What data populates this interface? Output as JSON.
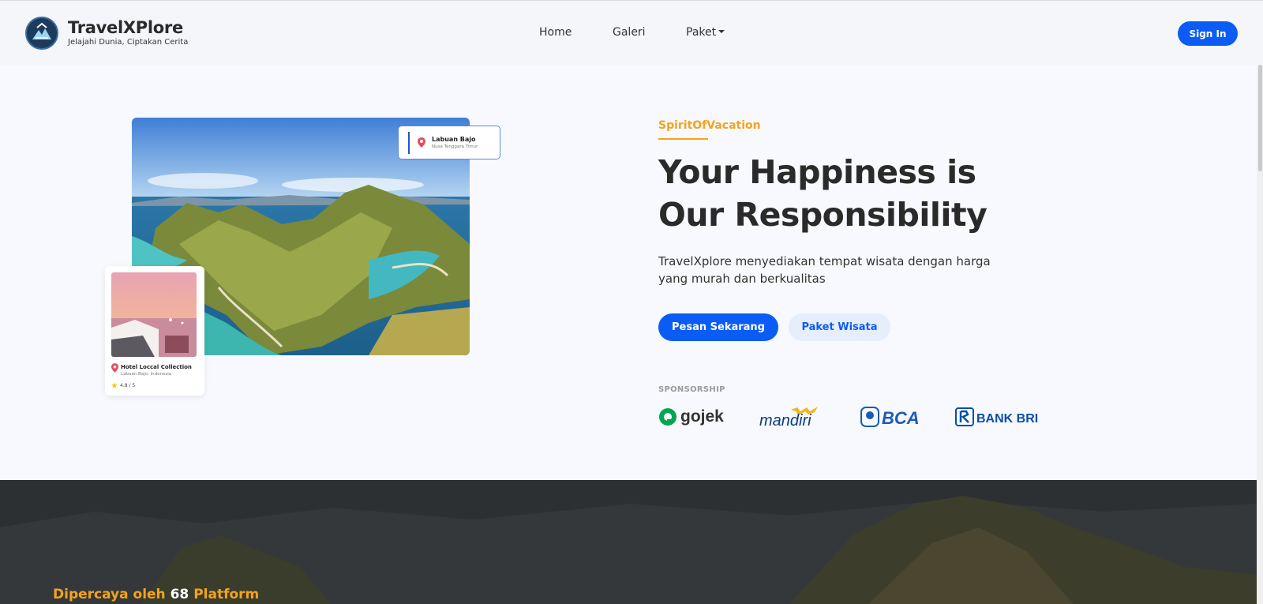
{
  "brand": {
    "name": "TravelXPlore",
    "tagline": "Jelajahi Dunia, Ciptakan Cerita"
  },
  "nav": {
    "items": [
      "Home",
      "Galeri",
      "Paket"
    ],
    "signin_label": "Sign In"
  },
  "hero": {
    "kicker": "SpiritOfVacation",
    "headline_line1": "Your Happiness is",
    "headline_line2": "Our Responsibility",
    "subtext": "TravelXplore menyediakan tempat wisata dengan harga yang murah dan berkualitas",
    "primary_button": "Pesan Sekarang",
    "secondary_button": "Paket Wisata"
  },
  "location_card": {
    "title": "Labuan Bajo",
    "subtitle": "Nusa Tenggara Timur"
  },
  "hotel_card": {
    "name": "Hotel Loccal Collection",
    "location": "Labuan Bajo, Indonesia",
    "rating": "4.8 / 5"
  },
  "sponsorship": {
    "label": "SPONSORSHIP",
    "sponsors": [
      "gojek",
      "mandiri",
      "BCA",
      "BANK BRI"
    ]
  },
  "trusted": {
    "prefix": "Dipercaya oleh",
    "count": "68",
    "suffix": "Platform"
  },
  "colors": {
    "primary": "#0b5cf5",
    "accent": "#f5a31a",
    "text": "#2a2a2a",
    "background": "#f7f9fe"
  }
}
